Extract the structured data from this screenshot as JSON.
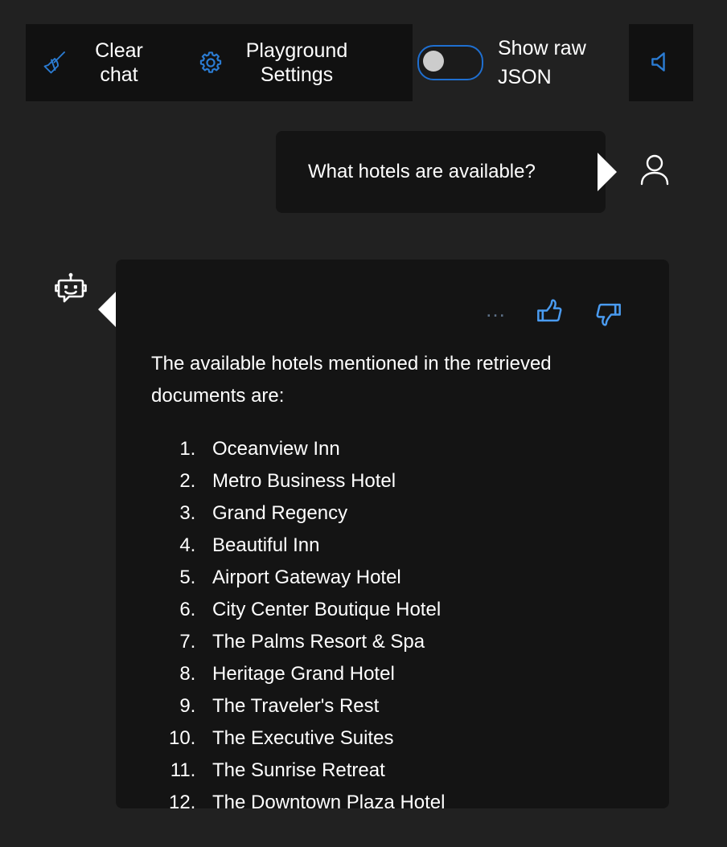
{
  "toolbar": {
    "clear_chat": {
      "label": "Clear\nchat",
      "icon": "broom-icon"
    },
    "playground_settings": {
      "label": "Playground\nSettings",
      "icon": "gear-icon"
    },
    "show_raw_json": {
      "label": "Show raw\nJSON",
      "state": "off"
    },
    "speaker": {
      "icon": "speaker-mute-icon"
    },
    "accent_color": "#2b7cd3",
    "panel_color": "#111111"
  },
  "chat": {
    "user_message": {
      "text": "What hotels are available?",
      "avatar": "person-icon"
    },
    "bot_message": {
      "avatar": "robot-icon",
      "actions": {
        "more": "…",
        "thumbs_up": "thumbs-up-icon",
        "thumbs_down": "thumbs-down-icon"
      },
      "paragraph": "The available hotels mentioned in the retrieved documents are:",
      "hotels": [
        "Oceanview Inn",
        "Metro Business Hotel",
        "Grand Regency",
        "Beautiful Inn",
        "Airport Gateway Hotel",
        "City Center Boutique Hotel",
        "The Palms Resort & Spa",
        "Heritage Grand Hotel",
        "The Traveler's Rest",
        "The Executive Suites",
        "The Sunrise Retreat",
        "The Downtown Plaza Hotel"
      ]
    }
  },
  "colors": {
    "page_background": "#212121",
    "bubble_background": "#141414",
    "text": "#ffffff",
    "accent_blue": "#2b7cd3"
  }
}
